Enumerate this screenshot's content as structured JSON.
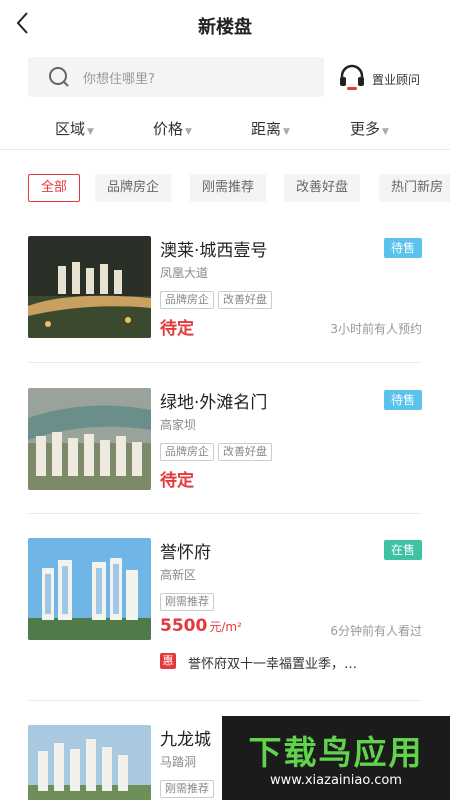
{
  "header": {
    "title": "新楼盘"
  },
  "search": {
    "placeholder": "你想住哪里?"
  },
  "advisor": {
    "label": "置业顾问"
  },
  "filters": [
    {
      "label": "区域"
    },
    {
      "label": "价格"
    },
    {
      "label": "距离"
    },
    {
      "label": "更多"
    }
  ],
  "tags": [
    {
      "label": "全部",
      "active": true
    },
    {
      "label": "品牌房企"
    },
    {
      "label": "刚需推荐"
    },
    {
      "label": "改善好盘"
    },
    {
      "label": "热门新房"
    }
  ],
  "listings": [
    {
      "name": "澳莱·城西壹号",
      "area": "凤凰大道",
      "status": "待售",
      "chips": [
        "品牌房企",
        "改善好盘"
      ],
      "price": "待定",
      "price_unit": "",
      "hint": "3小时前有人预约"
    },
    {
      "name": "绿地·外滩名门",
      "area": "高家坝",
      "status": "待售",
      "chips": [
        "品牌房企",
        "改善好盘"
      ],
      "price": "待定",
      "price_unit": "",
      "hint": ""
    },
    {
      "name": "誉怀府",
      "area": "高新区",
      "status": "在售",
      "chips": [
        "刚需推荐"
      ],
      "price": "5500",
      "price_unit": "元/m²",
      "hint": "6分钟前有人看过",
      "promo_badge": "惠",
      "promo_text": "誉怀府双十一幸福置业季，…"
    },
    {
      "name": "九龙城",
      "area": "马踏洞",
      "status": "",
      "chips": [
        "刚需推荐"
      ],
      "price": "",
      "price_unit": "",
      "hint": ""
    }
  ],
  "watermark": {
    "big": "下载鸟应用",
    "small": "www.xiazainiao.com"
  },
  "colors": {
    "accent_red": "#e4393c",
    "status_pending": "#5ac3ec",
    "status_selling": "#3fc2a4"
  }
}
